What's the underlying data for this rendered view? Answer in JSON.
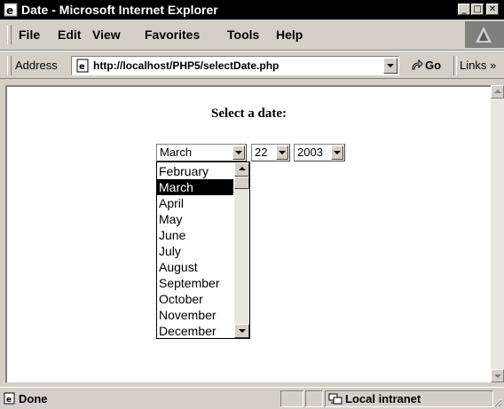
{
  "window": {
    "title": "Date - Microsoft Internet Explorer",
    "minimize_glyph": "_",
    "maximize_glyph": "□",
    "close_glyph": "✕"
  },
  "menu": {
    "items": [
      "File",
      "Edit",
      "View",
      "Favorites",
      "Tools",
      "Help"
    ]
  },
  "address_bar": {
    "label": "Address",
    "url": "http://localhost/PHP5/selectDate.php",
    "go_label": "Go",
    "links_label": "Links »"
  },
  "page": {
    "heading": "Select a date:",
    "month_select": {
      "value": "March",
      "options": [
        "February",
        "March",
        "April",
        "May",
        "June",
        "July",
        "August",
        "September",
        "October",
        "November",
        "December"
      ],
      "selected_index": 1
    },
    "day_select": {
      "value": "22"
    },
    "year_select": {
      "value": "2003"
    }
  },
  "status_bar": {
    "text": "Done",
    "zone": "Local intranet"
  }
}
